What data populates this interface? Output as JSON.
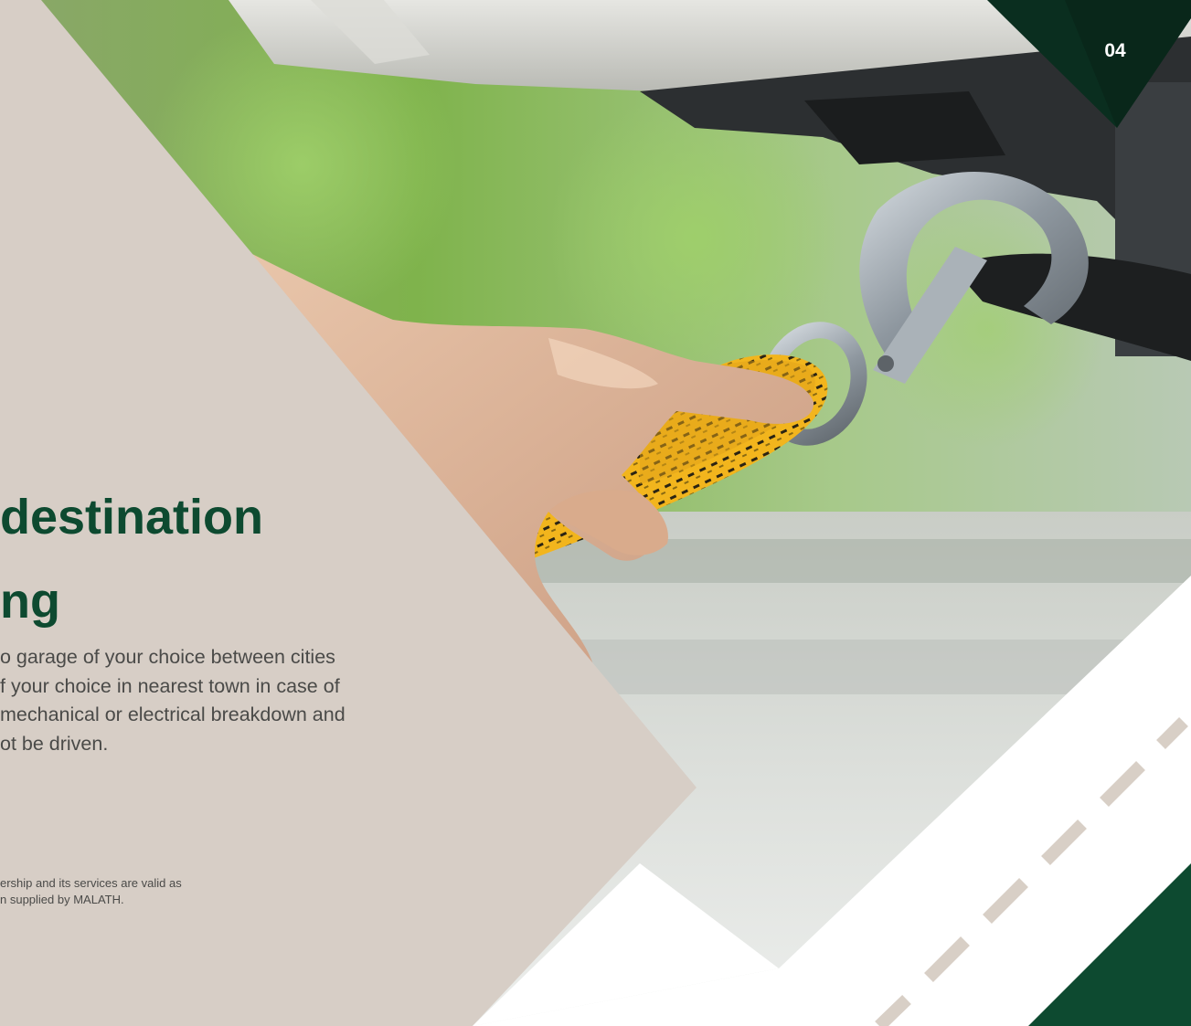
{
  "page": {
    "number": "04"
  },
  "headline": {
    "line1": "destination",
    "line2": "ng"
  },
  "body": {
    "lines": [
      "o garage of your choice between cities",
      "f your choice in  nearest town in case of",
      "mechanical or electrical breakdown and",
      "ot be driven."
    ]
  },
  "footnote": {
    "lines": [
      "ership and its services are valid as",
      "n supplied by MALATH."
    ]
  },
  "colors": {
    "brand_green": "#0d4a30",
    "dark_green": "#0a2e1f",
    "beige_panel": "#d7cec6",
    "road_dash": "#d8cfc6",
    "body_text": "#4a4a48"
  }
}
